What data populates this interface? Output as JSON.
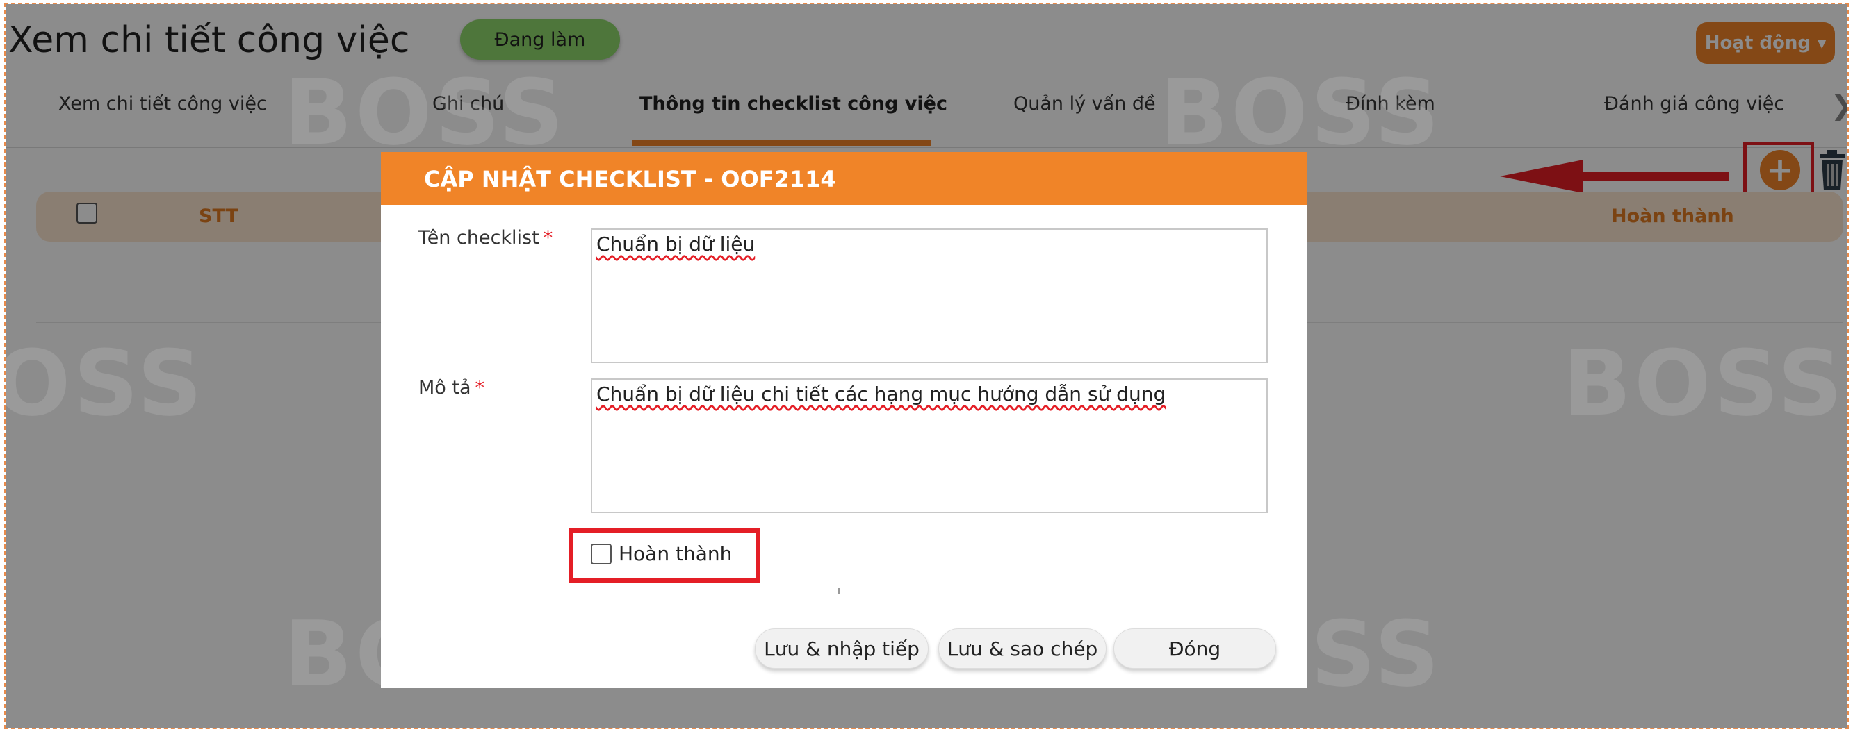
{
  "header": {
    "title": "Xem chi tiết công việc",
    "status": "Đang làm",
    "action_label": "Hoạt động"
  },
  "tabs": [
    {
      "label": "Xem chi tiết công việc"
    },
    {
      "label": "Ghi chú"
    },
    {
      "label": "Thông tin checklist công việc"
    },
    {
      "label": "Quản lý vấn đề"
    },
    {
      "label": "Đính kèm"
    },
    {
      "label": "Đánh giá công việc"
    }
  ],
  "table": {
    "col_stt": "STT",
    "col_done": "Hoàn thành"
  },
  "watermark": "BOSS",
  "modal": {
    "title": "CẬP NHẬT CHECKLIST - OOF2114",
    "name_label": "Tên checklist",
    "name_value": "Chuẩn bị dữ liệu",
    "desc_label": "Mô tả",
    "desc_value": "Chuẩn bị dữ liệu chi tiết các hạng mục hướng dẫn sử dụng",
    "required_mark": "*",
    "done_label": "Hoàn thành",
    "buttons": {
      "save_continue": "Lưu & nhập tiếp",
      "save_copy": "Lưu & sao chép",
      "close": "Đóng"
    }
  },
  "colors": {
    "accent": "#f08428",
    "status_green": "#8ed76c",
    "highlight_red": "#e41e26"
  }
}
